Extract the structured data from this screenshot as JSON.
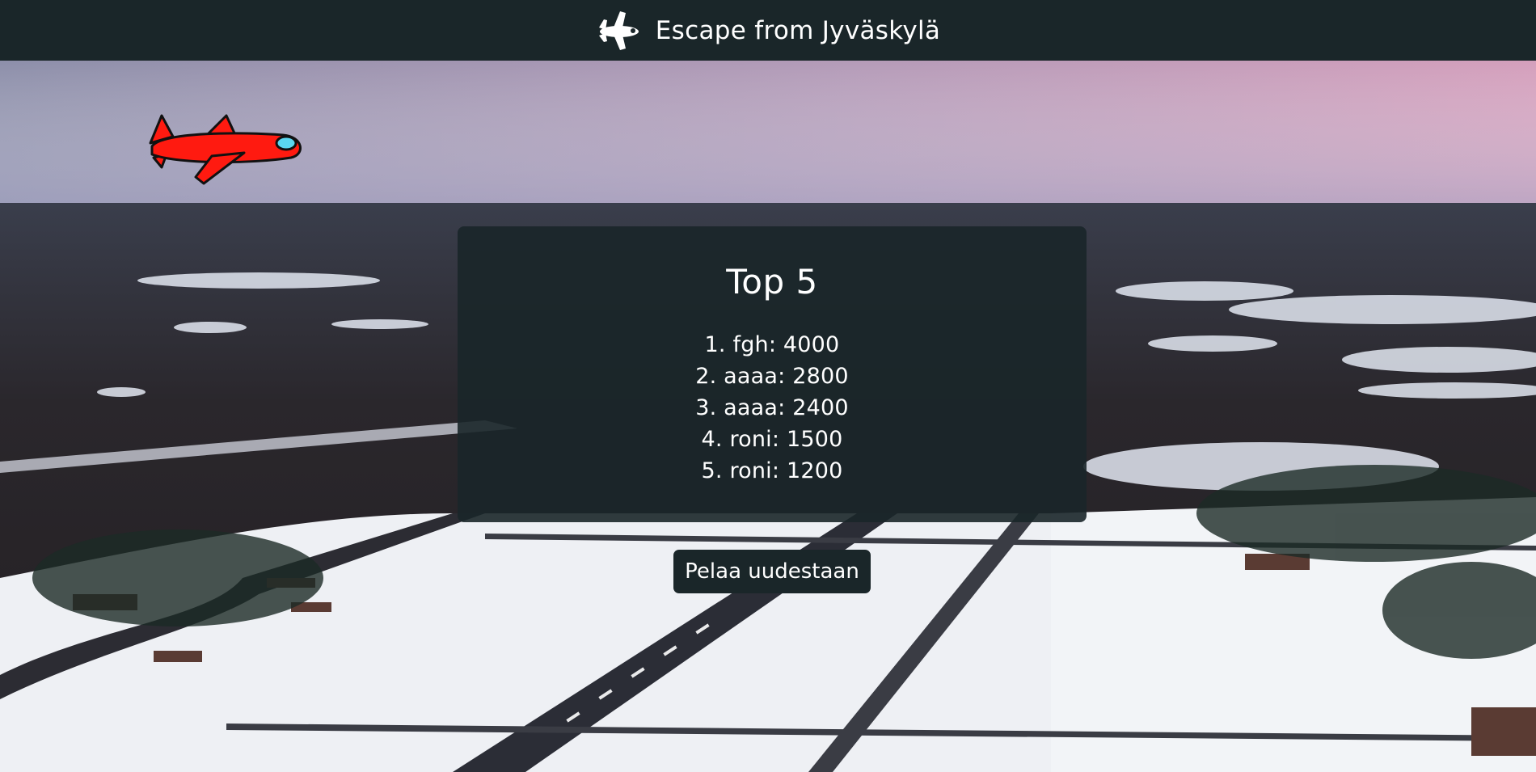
{
  "header": {
    "title": "Escape from Jyväskylä",
    "icon": "airplane-icon"
  },
  "scene": {
    "player_icon": "red-airplane-icon"
  },
  "leaderboard": {
    "title": "Top 5",
    "entries": [
      "1. fgh: 4000",
      "2. aaaa: 2800",
      "3. aaaa: 2400",
      "4. roni: 1500",
      "5. roni: 1200"
    ]
  },
  "actions": {
    "play_again_label": "Pelaa uudestaan"
  },
  "colors": {
    "panel": "#1a2629",
    "plane": "#ff1a10",
    "text": "#ffffff"
  }
}
